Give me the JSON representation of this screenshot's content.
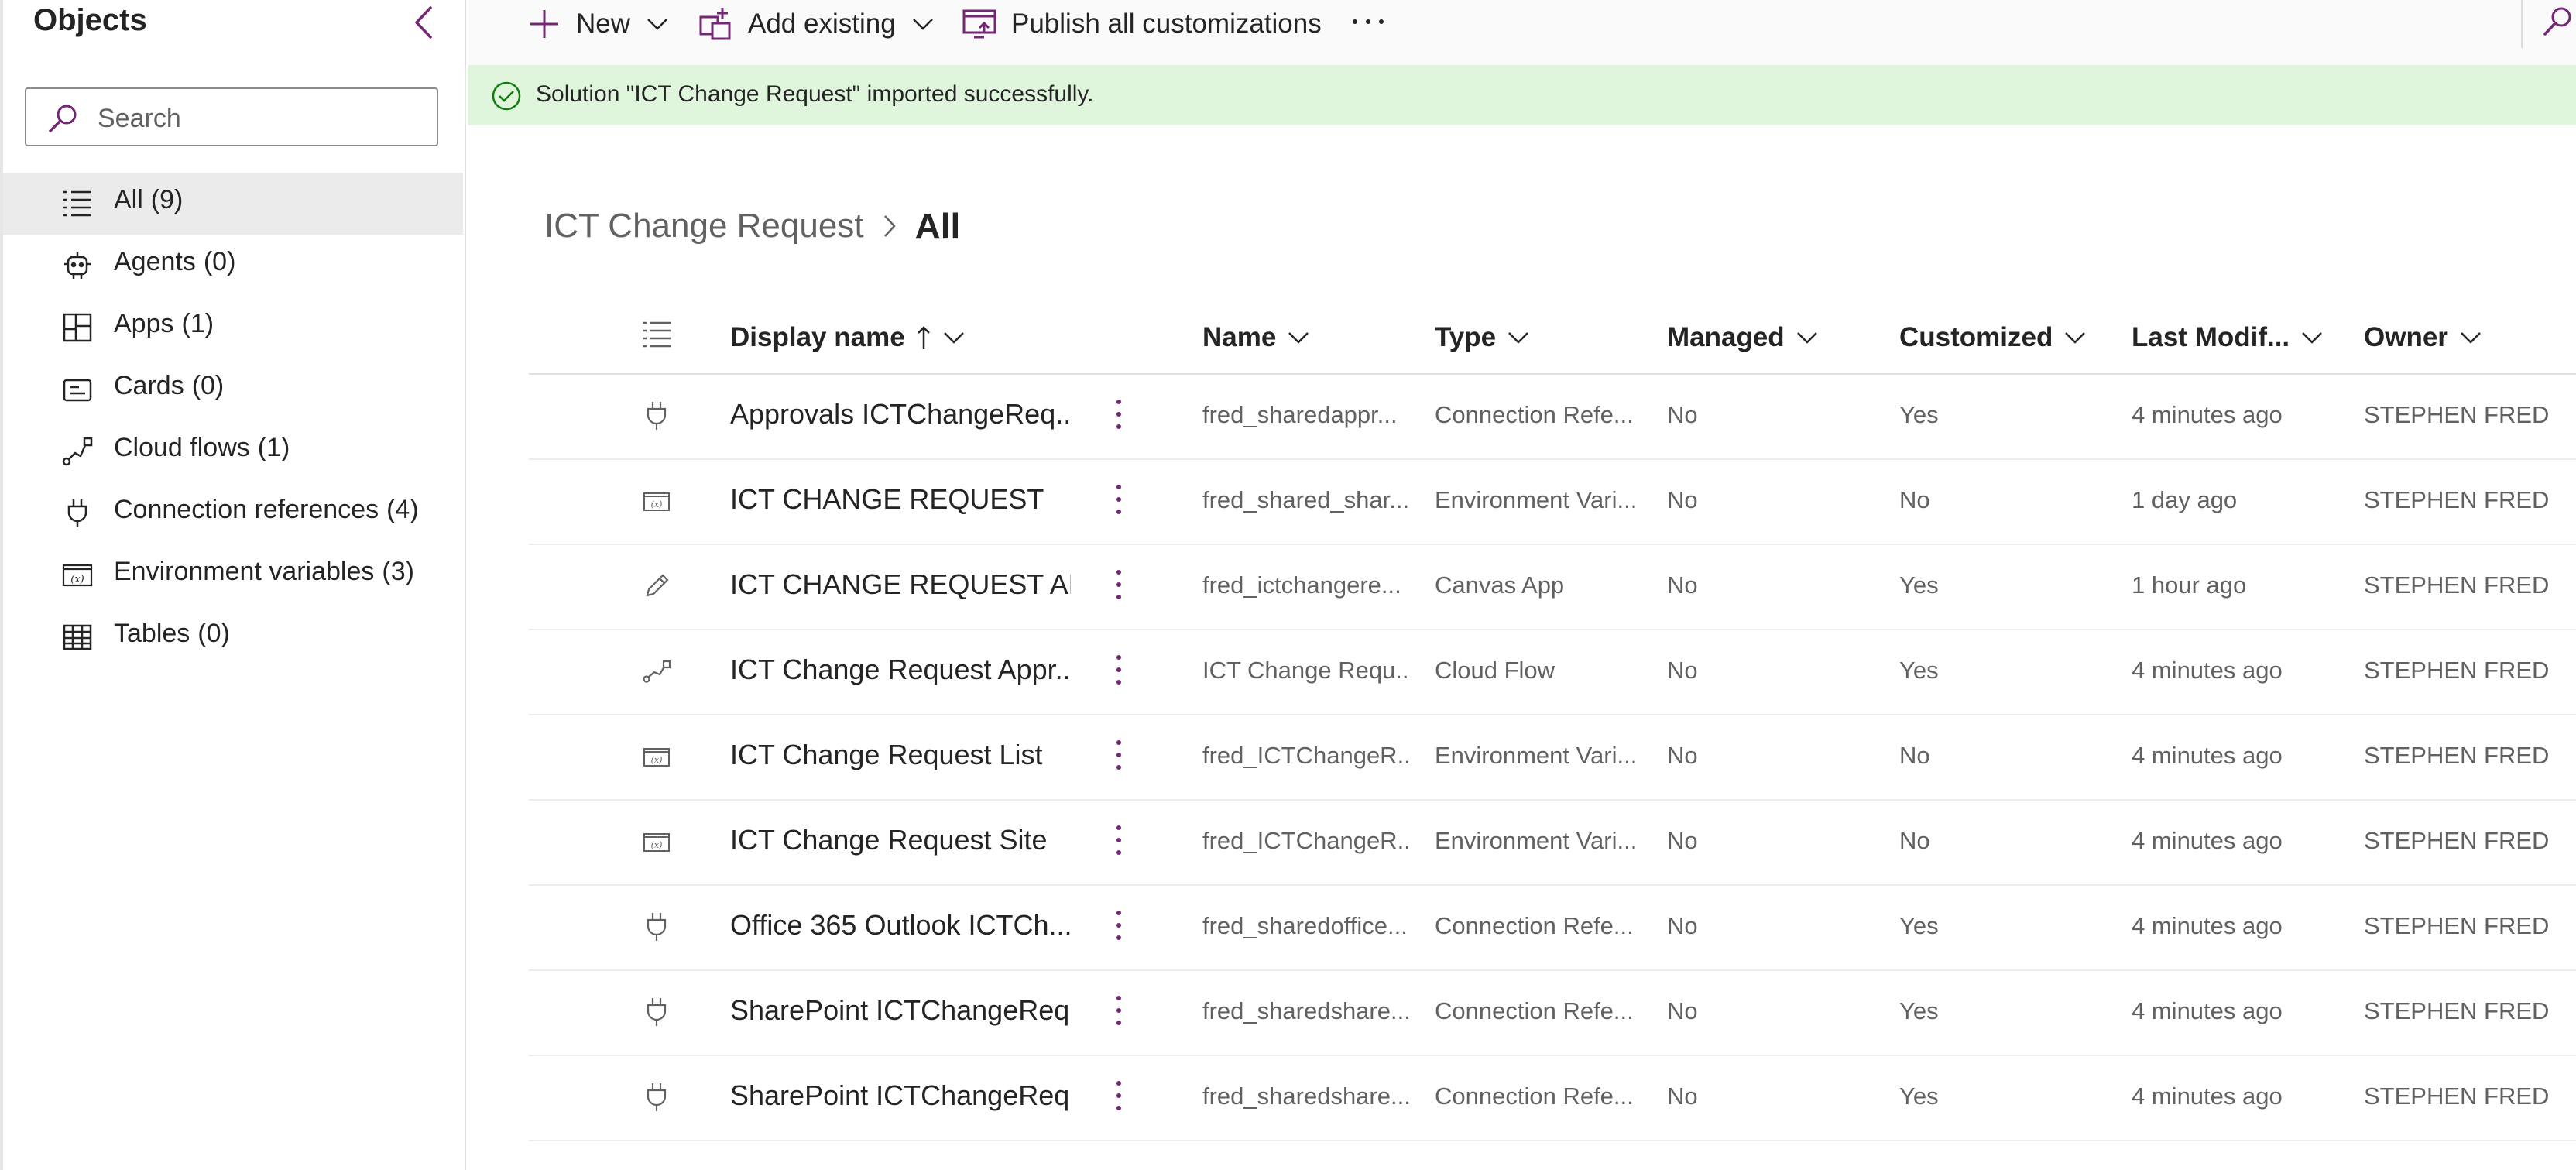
{
  "objects_pane": {
    "title": "Objects",
    "search_placeholder": "Search",
    "items": [
      {
        "label": "All",
        "count": "(9)",
        "icon": "list-icon",
        "active": true
      },
      {
        "label": "Agents",
        "count": "(0)",
        "icon": "bot-icon"
      },
      {
        "label": "Apps",
        "count": "(1)",
        "icon": "apps-icon"
      },
      {
        "label": "Cards",
        "count": "(0)",
        "icon": "card-icon"
      },
      {
        "label": "Cloud flows",
        "count": "(1)",
        "icon": "flow-icon"
      },
      {
        "label": "Connection references",
        "count": "(4)",
        "icon": "plug-icon"
      },
      {
        "label": "Environment variables",
        "count": "(3)",
        "icon": "variable-icon"
      },
      {
        "label": "Tables",
        "count": "(0)",
        "icon": "table-icon"
      }
    ]
  },
  "command_bar": {
    "new_label": "New",
    "add_existing_label": "Add existing",
    "publish_label": "Publish all customizations"
  },
  "banner": {
    "text": "Solution \"ICT Change Request\" imported successfully.",
    "status_color": "#107c10"
  },
  "breadcrumb": {
    "parent": "ICT Change Request",
    "current": "All"
  },
  "grid": {
    "columns": {
      "display_name": "Display name",
      "name": "Name",
      "type": "Type",
      "managed": "Managed",
      "customized": "Customized",
      "last_modified": "Last Modif...",
      "owner": "Owner"
    },
    "sort": "ascending",
    "rows": [
      {
        "icon": "plug-icon",
        "display_name": "Approvals ICTChangeReq...",
        "name": "fred_sharedappr...",
        "type": "Connection Refe...",
        "managed": "No",
        "customized": "Yes",
        "last_modified": "4 minutes ago",
        "owner": "STEPHEN FRED"
      },
      {
        "icon": "variable-icon",
        "display_name": "ICT CHANGE REQUEST",
        "name": "fred_shared_shar...",
        "type": "Environment Vari...",
        "managed": "No",
        "customized": "No",
        "last_modified": "1 day ago",
        "owner": "STEPHEN FRED"
      },
      {
        "icon": "pencil-icon",
        "display_name": "ICT CHANGE REQUEST APP",
        "name": "fred_ictchangere...",
        "type": "Canvas App",
        "managed": "No",
        "customized": "Yes",
        "last_modified": "1 hour ago",
        "owner": "STEPHEN FRED"
      },
      {
        "icon": "flow-icon",
        "display_name": "ICT Change Request Appr...",
        "name": "ICT Change Requ...",
        "type": "Cloud Flow",
        "managed": "No",
        "customized": "Yes",
        "last_modified": "4 minutes ago",
        "owner": "STEPHEN FRED"
      },
      {
        "icon": "variable-icon",
        "display_name": "ICT Change Request List",
        "name": "fred_ICTChangeR...",
        "type": "Environment Vari...",
        "managed": "No",
        "customized": "No",
        "last_modified": "4 minutes ago",
        "owner": "STEPHEN FRED"
      },
      {
        "icon": "variable-icon",
        "display_name": "ICT Change Request Site",
        "name": "fred_ICTChangeR...",
        "type": "Environment Vari...",
        "managed": "No",
        "customized": "No",
        "last_modified": "4 minutes ago",
        "owner": "STEPHEN FRED"
      },
      {
        "icon": "plug-icon",
        "display_name": "Office 365 Outlook ICTCh...",
        "name": "fred_sharedoffice...",
        "type": "Connection Refe...",
        "managed": "No",
        "customized": "Yes",
        "last_modified": "4 minutes ago",
        "owner": "STEPHEN FRED"
      },
      {
        "icon": "plug-icon",
        "display_name": "SharePoint ICTChangeReq...",
        "name": "fred_sharedshare...",
        "type": "Connection Refe...",
        "managed": "No",
        "customized": "Yes",
        "last_modified": "4 minutes ago",
        "owner": "STEPHEN FRED"
      },
      {
        "icon": "plug-icon",
        "display_name": "SharePoint ICTChangeReq...",
        "name": "fred_sharedshare...",
        "type": "Connection Refe...",
        "managed": "No",
        "customized": "Yes",
        "last_modified": "4 minutes ago",
        "owner": "STEPHEN FRED"
      }
    ]
  },
  "colors": {
    "accent": "#742774",
    "banner_bg": "#dff6dd",
    "text": "#242424",
    "muted_text": "#616161"
  }
}
